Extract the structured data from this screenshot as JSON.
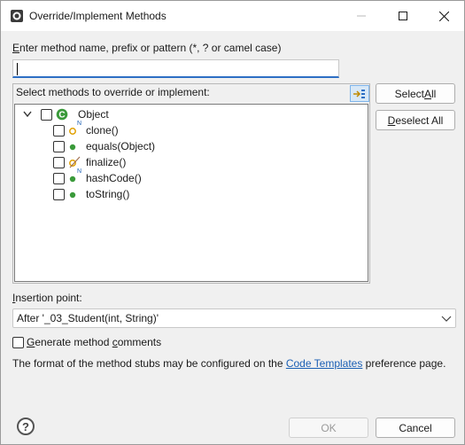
{
  "window": {
    "title": "Override/Implement Methods"
  },
  "filter": {
    "label": "Enter method name, prefix or pattern (*, ? or camel case)",
    "label_mnemonic": "E",
    "label_rest": "nter method name, prefix or pattern (*, ? or camel case)",
    "value": ""
  },
  "methods": {
    "label": "Select methods to override or implement:",
    "root": {
      "label": "Object",
      "checked": false,
      "expanded": true
    },
    "items": [
      {
        "label": "clone()",
        "checked": false,
        "marker": "N",
        "visibility": "protected"
      },
      {
        "label": "equals(Object)",
        "checked": false,
        "marker": "",
        "visibility": "public"
      },
      {
        "label": "finalize()",
        "checked": false,
        "marker": "",
        "visibility": "protected-deprecated"
      },
      {
        "label": "hashCode()",
        "checked": false,
        "marker": "N",
        "visibility": "public"
      },
      {
        "label": "toString()",
        "checked": false,
        "marker": "",
        "visibility": "public"
      }
    ]
  },
  "buttons": {
    "select_all": {
      "before": "Select ",
      "mnemonic": "A",
      "after": "ll"
    },
    "deselect_all": {
      "before": "",
      "mnemonic": "D",
      "after": "eselect All"
    },
    "ok": "OK",
    "cancel": "Cancel"
  },
  "insertion": {
    "label_mnemonic": "I",
    "label_rest": "nsertion point:",
    "value": "After '_03_Student(int, String)'"
  },
  "generate_comments": {
    "mnemonic": "G",
    "rest": "enerate method ",
    "mnemonic2": "c",
    "rest2": "omments",
    "checked": false
  },
  "info": {
    "before": "The format of the method stubs may be configured on the ",
    "link": "Code Templates",
    "after": " preference page."
  },
  "help": {
    "symbol": "?"
  },
  "colors": {
    "accent": "#2d6fc4",
    "method_public": "#3a9a3a",
    "method_protected": "#e0a000",
    "class_icon": "#3a9a3a",
    "link": "#1a5fb4"
  },
  "icons": {
    "app": "eclipse-dialog-icon",
    "root": "class-c-icon",
    "sort": "sort-members-icon"
  }
}
